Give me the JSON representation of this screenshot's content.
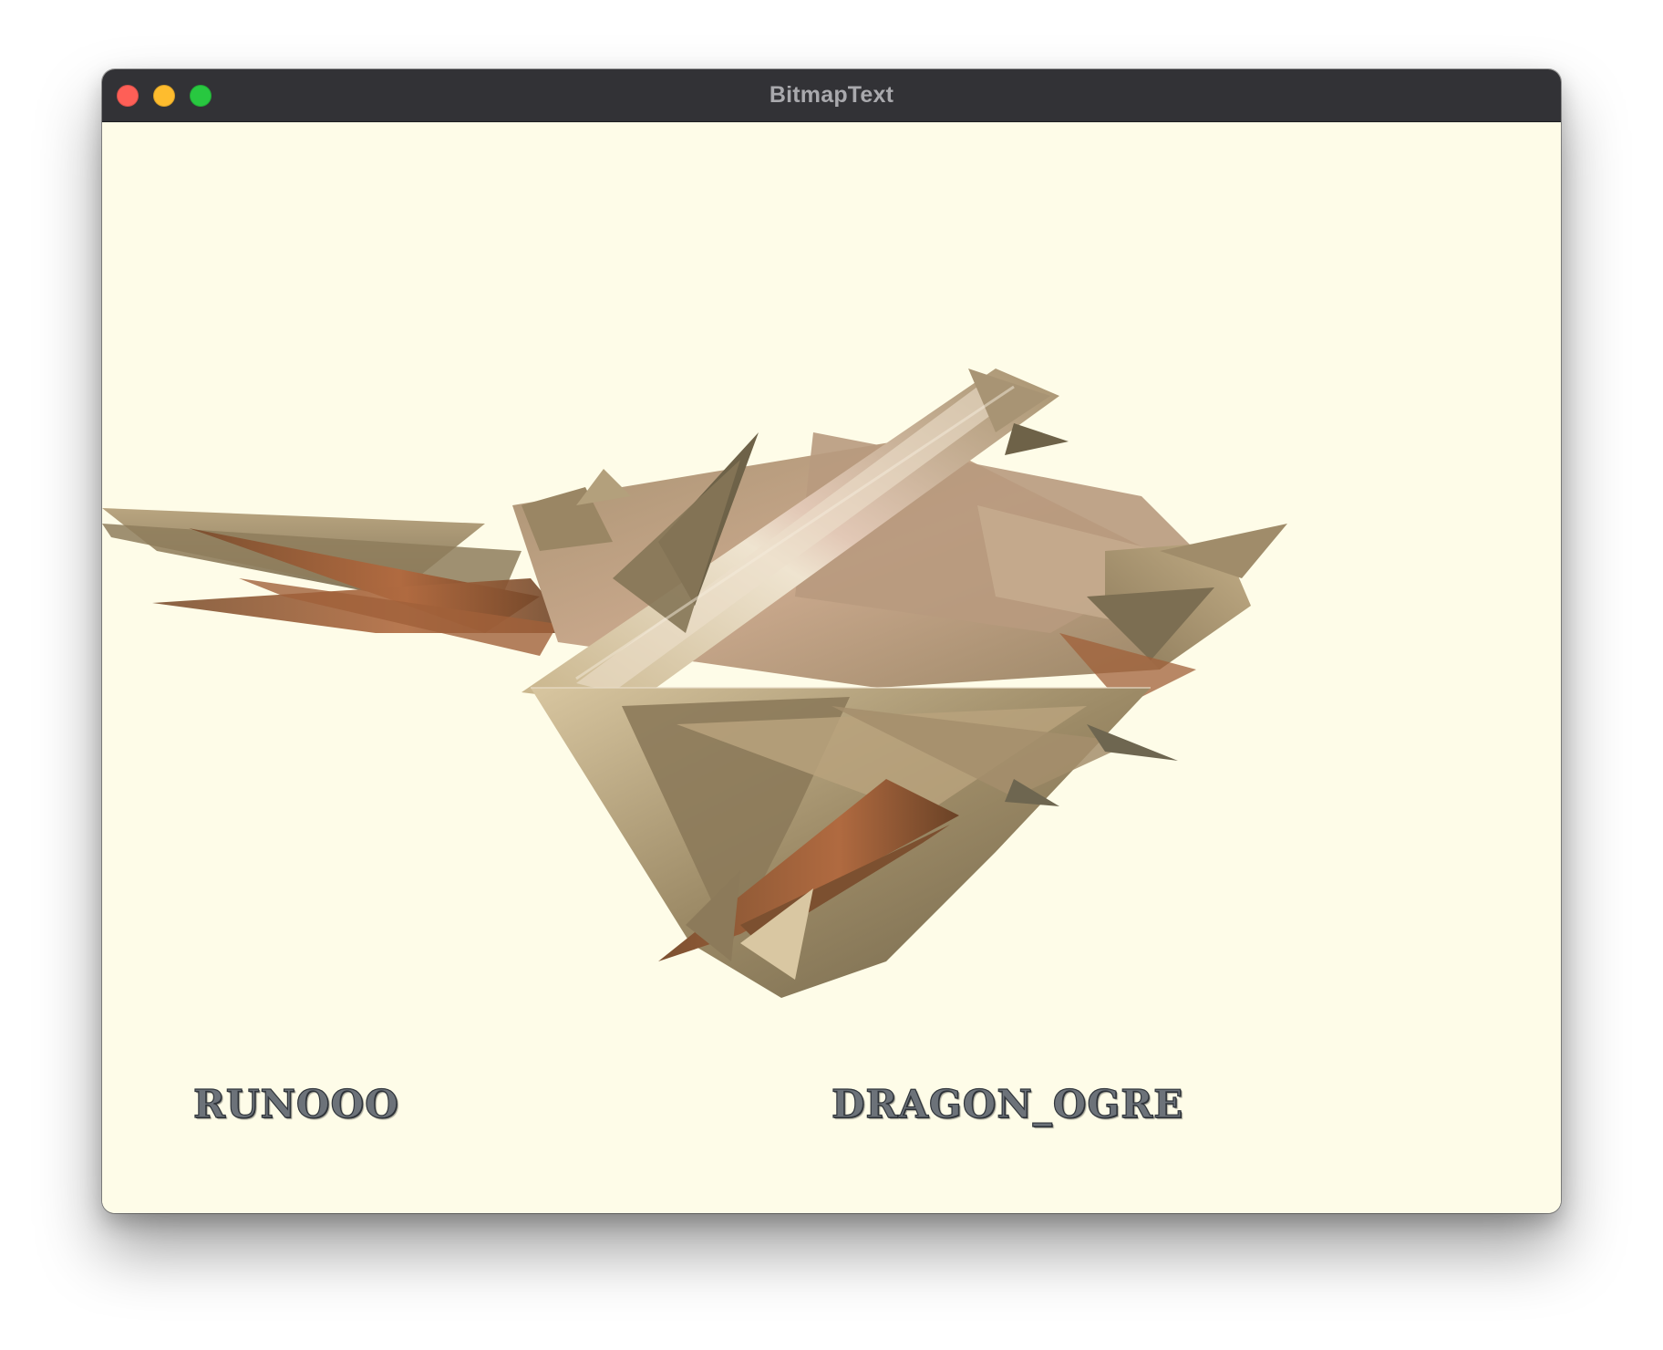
{
  "window": {
    "title": "BitmapText"
  },
  "overlay": {
    "left_text": "RUNOOO",
    "right_text": "DRAGON_OGRE"
  },
  "scene": {
    "background": "#fefce8",
    "object_palette": [
      "#8a7a5c",
      "#b6a07a",
      "#d9c7a2",
      "#7a4a2a",
      "#a0603a",
      "#e8dcc8",
      "#6e6650"
    ]
  },
  "icons": {
    "close": "close-icon",
    "minimize": "minimize-icon",
    "zoom": "zoom-icon"
  }
}
